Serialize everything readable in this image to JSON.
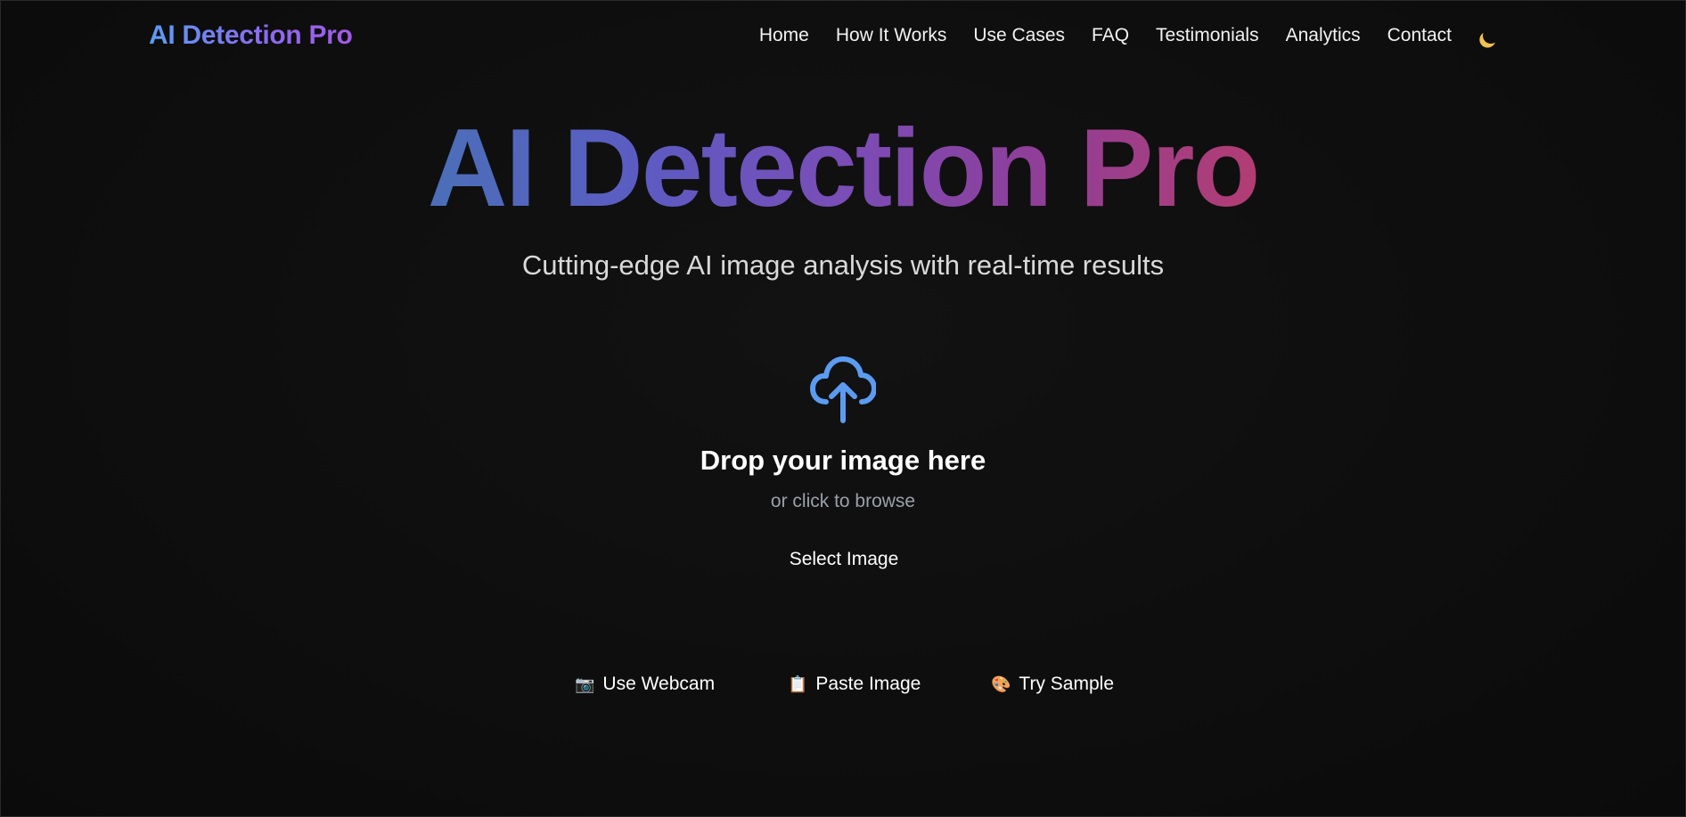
{
  "navbar": {
    "brand": "AI Detection Pro",
    "links": [
      "Home",
      "How It Works",
      "Use Cases",
      "FAQ",
      "Testimonials",
      "Analytics",
      "Contact"
    ],
    "theme_icon": "moon-icon"
  },
  "hero": {
    "title": "AI Detection Pro",
    "subtitle": "Cutting-edge AI image analysis with real-time results"
  },
  "upload": {
    "icon": "cloud-upload-icon",
    "drop_title": "Drop your image here",
    "drop_sub": "or click to browse",
    "select_button": "Select Image"
  },
  "actions": {
    "webcam": {
      "emoji": "📷",
      "label": "Use Webcam"
    },
    "paste": {
      "emoji": "📋",
      "label": "Paste Image"
    },
    "sample": {
      "emoji": "🎨",
      "label": "Try Sample"
    }
  },
  "colors": {
    "background": "#0e0e0e",
    "brand_gradient_start": "#5b9cf2",
    "brand_gradient_end": "#a25ae8",
    "hero_gradient_start": "#4b6fb8",
    "hero_gradient_end": "#b23d72",
    "upload_icon": "#5b9cf2",
    "moon": "#f2c14e"
  }
}
